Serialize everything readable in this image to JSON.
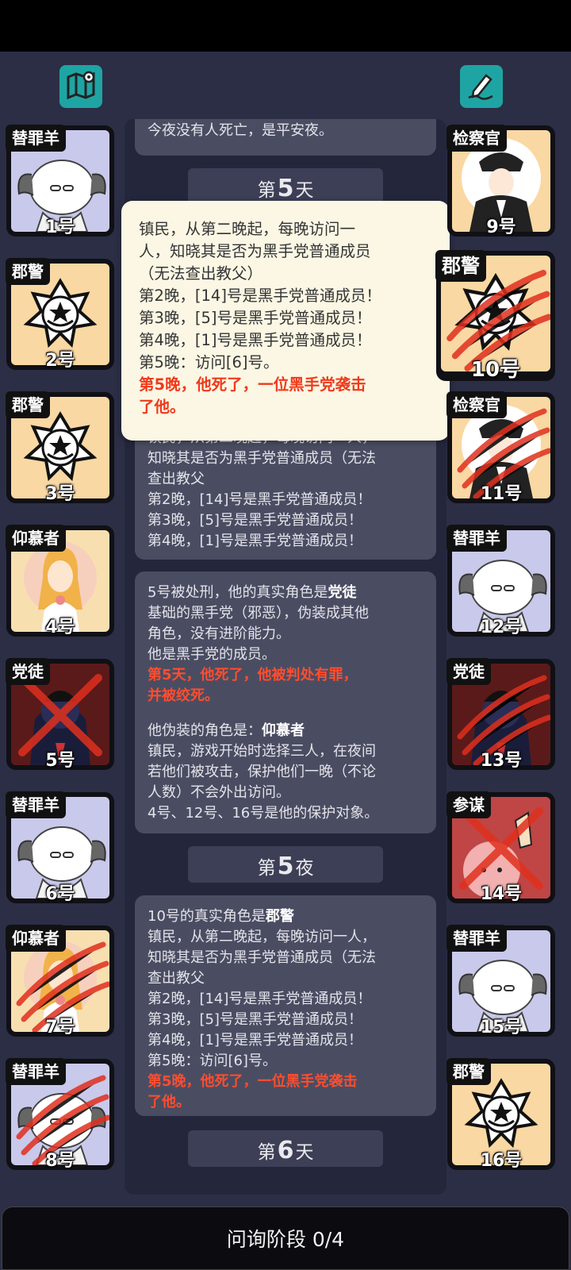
{
  "top": {
    "map_icon": "map-pin-icon",
    "notes_icon": "pencil-icon"
  },
  "log": {
    "msg_top": "今夜没有人死亡，是平安夜。",
    "day5_prefix": "第",
    "day5_num": "5",
    "day5_suffix": "天",
    "msg_police_a": [
      "镇民，从第二晚起，每晚访问一人，",
      "知晓其是否为黑手党普通成员（无法",
      "查出教父",
      "第2晚，[14]号是黑手党普通成员！",
      "第3晚，[5]号是黑手党普通成员！",
      "第4晚，[1]号是黑手党普通成员！"
    ],
    "exec_msg": {
      "line1_prefix": "5号被处刑，他的真实角色是",
      "line1_role": "党徒",
      "line2": "基础的黑手党（邪恶），伪装成其他",
      "line3": "角色，没有进阶能力。",
      "line4": "他是黑手党的成员。",
      "red1": "第5天，他死了，他被判处有罪，",
      "red2": "并被绞死。",
      "disguise_prefix": "他伪装的角色是：",
      "disguise_role": "仰慕者",
      "d1": "镇民，游戏开始时选择三人，在夜间",
      "d2": "若他们被攻击，保护他们一晚（不论",
      "d3": "人数）不会外出访问。",
      "d4": "4号、12号、16号是他的保护对象。"
    },
    "night5_prefix": "第",
    "night5_num": "5",
    "night5_suffix": "夜",
    "reveal_msg": {
      "line1_prefix": "10号的真实角色是",
      "line1_role": "郡警",
      "l2": "镇民，从第二晚起，每晚访问一人，",
      "l3": "知晓其是否为黑手党普通成员（无法",
      "l4": "查出教父",
      "l5": "第2晚，[14]号是黑手党普通成员！",
      "l6": "第3晚，[5]号是黑手党普通成员！",
      "l7": "第4晚，[1]号是黑手党普通成员！",
      "l8": "第5晚：访问[6]号。",
      "red1": "第5晚，他死了，一位黑手党袭击",
      "red2": "了他。"
    },
    "day6_prefix": "第",
    "day6_num": "6",
    "day6_suffix": "天"
  },
  "popup": {
    "l1": "镇民，从第二晚起，每晚访问一",
    "l2": "人，知晓其是否为黑手党普通成员",
    "l3": "（无法查出教父）",
    "l4": "第2晚，[14]号是黑手党普通成员！",
    "l5": "第3晚，[5]号是黑手党普通成员！",
    "l6": "第4晚，[1]号是黑手党普通成员！",
    "l7": "第5晚：访问[6]号。",
    "red1": "第5晚，他死了，一位黑手党袭击",
    "red2": "了他。"
  },
  "players": {
    "p1": {
      "role": "替罪羊",
      "num": "1号"
    },
    "p2": {
      "role": "郡警",
      "num": "2号"
    },
    "p3": {
      "role": "郡警",
      "num": "3号"
    },
    "p4": {
      "role": "仰慕者",
      "num": "4号"
    },
    "p5": {
      "role": "党徒",
      "num": "5号"
    },
    "p6": {
      "role": "替罪羊",
      "num": "6号"
    },
    "p7": {
      "role": "仰慕者",
      "num": "7号"
    },
    "p8": {
      "role": "替罪羊",
      "num": "8号"
    },
    "p9": {
      "role": "检察官",
      "num": "9号"
    },
    "p10": {
      "role": "郡警",
      "num": "10号"
    },
    "p11": {
      "role": "检察官",
      "num": "11号"
    },
    "p12": {
      "role": "替罪羊",
      "num": "12号"
    },
    "p13": {
      "role": "党徒",
      "num": "13号"
    },
    "p14": {
      "role": "参谋",
      "num": "14号"
    },
    "p15": {
      "role": "替罪羊",
      "num": "15号"
    },
    "p16": {
      "role": "郡警",
      "num": "16号"
    }
  },
  "bottom": {
    "phase_label": "问询阶段 0/4"
  },
  "colors": {
    "background": "#2b2e45",
    "accent_teal": "#1fa4a4",
    "death_red": "#ff4d2e",
    "popup_bg": "#fbf7e4"
  }
}
